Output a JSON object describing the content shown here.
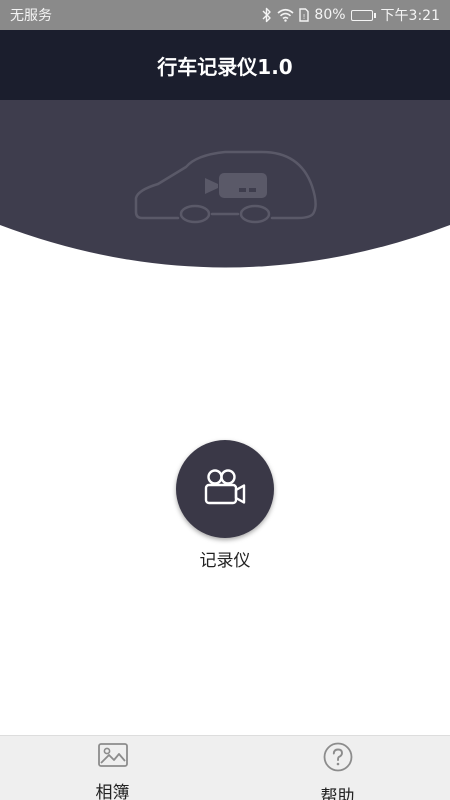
{
  "status_bar": {
    "carrier": "无服务",
    "battery": "80%",
    "battery_level": 0.8,
    "time": "下午3:21",
    "icons": [
      "bluetooth-icon",
      "wifi-icon",
      "sim-icon",
      "battery-icon"
    ]
  },
  "header": {
    "title": "行车记录仪1.0"
  },
  "hero": {
    "illustration": "car-camera-illustration",
    "background_color": "#3e3d4d",
    "line_color": "#5a5968"
  },
  "main": {
    "record_button": {
      "label": "记录仪",
      "icon": "video-camera-icon",
      "color": "#3a3847"
    }
  },
  "bottom_nav": {
    "items": [
      {
        "label": "相簿",
        "icon": "image-icon"
      },
      {
        "label": "帮助",
        "icon": "help-icon"
      }
    ]
  }
}
